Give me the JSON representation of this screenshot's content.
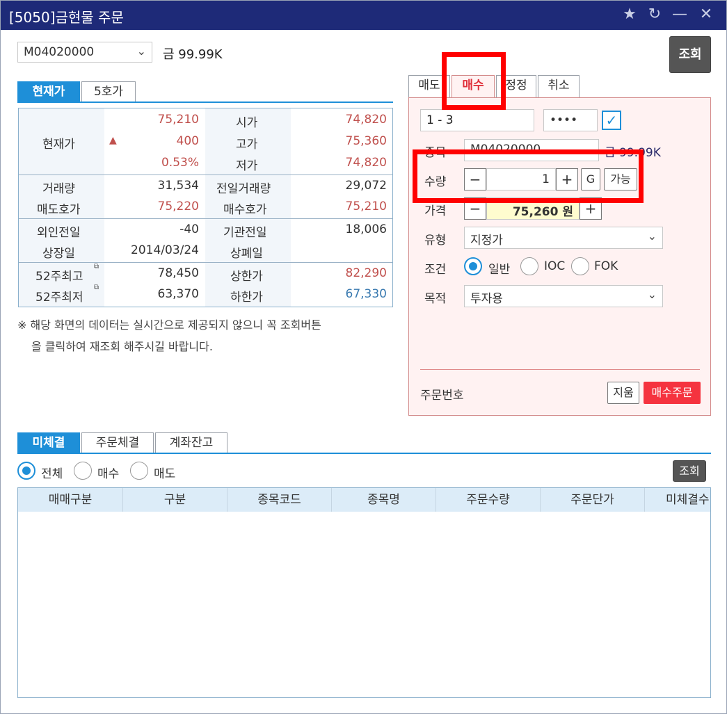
{
  "window": {
    "title": "[5050]금현물 주문"
  },
  "header": {
    "symbol_code": "M04020000",
    "symbol_name": "금 99.99K",
    "query_label": "조회"
  },
  "quote_tabs": [
    "현재가",
    "5호가"
  ],
  "quote": {
    "current_label": "현재가",
    "price": "75,210",
    "change": "400",
    "change_rate": "0.53%",
    "open_label": "시가",
    "open": "74,820",
    "high_label": "고가",
    "high": "75,360",
    "low_label": "저가",
    "low": "74,820",
    "volume_label": "거래량",
    "volume": "31,534",
    "prev_volume_label": "전일거래량",
    "prev_volume": "29,072",
    "ask_label": "매도호가",
    "ask": "75,220",
    "bid_label": "매수호가",
    "bid": "75,210",
    "foreign_label": "외인전일",
    "foreign": "-40",
    "inst_label": "기관전일",
    "inst": "18,006",
    "listing_label": "상장일",
    "listing": "2014/03/24",
    "delisting_label": "상폐일",
    "delisting": "",
    "high52_label": "52주최고",
    "high52": "78,450",
    "upper_label": "상한가",
    "upper": "82,290",
    "low52_label": "52주최저",
    "low52": "63,370",
    "lower_label": "하한가",
    "lower": "67,330",
    "colors": {
      "up": "#c0504d",
      "down": "#3a7ab0"
    }
  },
  "notice": {
    "line1": "※ 해당 화면의 데이터는 실시간으로 제공되지 않으니 꼭 조회버튼",
    "line2": "을 클릭하여 재조회 해주시길 바랍니다."
  },
  "order_tabs": [
    "매도",
    "매수",
    "정정",
    "취소"
  ],
  "order": {
    "account_value": "1          -           3",
    "password_value": "••••",
    "symbol_label": "종목",
    "symbol_code": "M04020000",
    "symbol_name": "금 99.99K",
    "qty_label": "수량",
    "qty": "1",
    "g_label": "G",
    "avail_label": "가능",
    "price_label": "가격",
    "price": "75,260",
    "price_unit": "원",
    "type_label": "유형",
    "type_value": "지정가",
    "cond_label": "조건",
    "cond_options": [
      "일반",
      "IOC",
      "FOK"
    ],
    "purpose_label": "목적",
    "purpose_value": "투자용",
    "order_no_label": "주문번호",
    "clear_label": "지움",
    "buy_label": "매수주문",
    "buy_color": "#f5333f"
  },
  "bottom_tabs": [
    "미체결",
    "주문체결",
    "계좌잔고"
  ],
  "filter": {
    "options": [
      "전체",
      "매수",
      "매도"
    ],
    "query_label": "조회"
  },
  "grid": {
    "columns": [
      "매매구분",
      "구분",
      "종목코드",
      "종목명",
      "주문수량",
      "주문단가",
      "미체결수"
    ]
  }
}
